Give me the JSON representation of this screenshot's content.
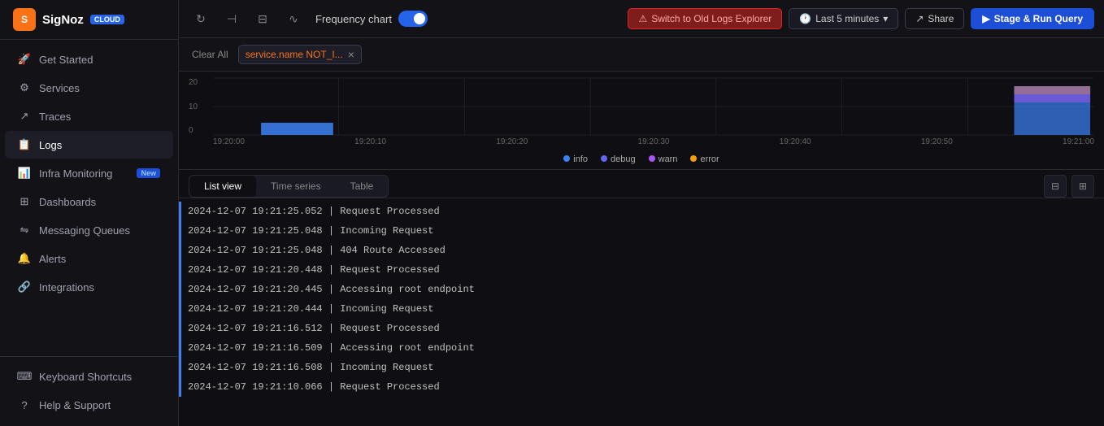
{
  "sidebar": {
    "logo": {
      "icon_text": "S",
      "name": "SigNoz",
      "badge": "CLOUD"
    },
    "nav_items": [
      {
        "id": "get-started",
        "label": "Get Started",
        "icon": "🚀"
      },
      {
        "id": "services",
        "label": "Services",
        "icon": "⚙"
      },
      {
        "id": "traces",
        "label": "Traces",
        "icon": "↗"
      },
      {
        "id": "logs",
        "label": "Logs",
        "icon": "📋",
        "active": true
      },
      {
        "id": "infra-monitoring",
        "label": "Infra Monitoring",
        "icon": "📊",
        "badge": "New"
      },
      {
        "id": "dashboards",
        "label": "Dashboards",
        "icon": "⊞"
      },
      {
        "id": "messaging-queues",
        "label": "Messaging Queues",
        "icon": "⇋"
      },
      {
        "id": "alerts",
        "label": "Alerts",
        "icon": "🔔"
      },
      {
        "id": "integrations",
        "label": "Integrations",
        "icon": "🔗"
      }
    ],
    "bottom_items": [
      {
        "id": "keyboard-shortcuts",
        "label": "Keyboard Shortcuts",
        "icon": "⌨"
      },
      {
        "id": "help-support",
        "label": "Help & Support",
        "icon": "?"
      }
    ]
  },
  "topbar": {
    "freq_label": "Frequency chart",
    "switch_old_label": "Switch to Old Logs Explorer",
    "time_label": "Last 5 minutes",
    "share_label": "Share",
    "run_label": "Stage & Run Query"
  },
  "filter_bar": {
    "clear_all": "Clear All",
    "filter_tag": "service.name NOT_I..."
  },
  "chart": {
    "y_labels": [
      "20",
      "10",
      "0"
    ],
    "x_labels": [
      "19:20:00",
      "19:20:10",
      "19:20:20",
      "19:20:30",
      "19:20:40",
      "19:20:50",
      "19:21:00"
    ],
    "legend": [
      {
        "label": "info",
        "color": "#3b82f6"
      },
      {
        "label": "debug",
        "color": "#6366f1"
      },
      {
        "label": "warn",
        "color": "#a855f7"
      },
      {
        "label": "error",
        "color": "#f59e0b"
      }
    ]
  },
  "log_tabs": {
    "tabs": [
      {
        "id": "list-view",
        "label": "List view",
        "active": true
      },
      {
        "id": "time-series",
        "label": "Time series",
        "active": false
      },
      {
        "id": "table",
        "label": "Table",
        "active": false
      }
    ]
  },
  "logs": [
    {
      "level": "info",
      "text": "2024-12-07 19:21:25.052 | Request Processed"
    },
    {
      "level": "info",
      "text": "2024-12-07 19:21:25.048 | Incoming Request"
    },
    {
      "level": "info",
      "text": "2024-12-07 19:21:25.048 | 404 Route Accessed"
    },
    {
      "level": "info",
      "text": "2024-12-07 19:21:20.448 | Request Processed"
    },
    {
      "level": "info",
      "text": "2024-12-07 19:21:20.445 | Accessing root endpoint"
    },
    {
      "level": "info",
      "text": "2024-12-07 19:21:20.444 | Incoming Request"
    },
    {
      "level": "info",
      "text": "2024-12-07 19:21:16.512 | Request Processed"
    },
    {
      "level": "info",
      "text": "2024-12-07 19:21:16.509 | Accessing root endpoint"
    },
    {
      "level": "info",
      "text": "2024-12-07 19:21:16.508 | Incoming Request"
    },
    {
      "level": "info",
      "text": "2024-12-07 19:21:10.066 | Request Processed"
    }
  ]
}
